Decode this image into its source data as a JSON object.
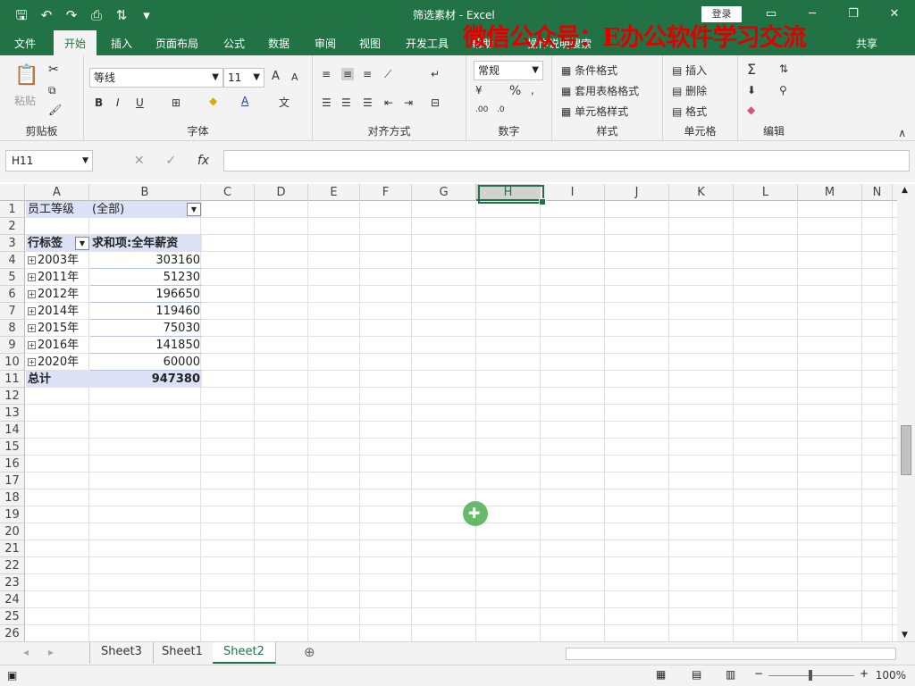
{
  "window": {
    "title": "筛选素材  -  Excel",
    "login": "登录"
  },
  "watermark": "微信公众号：E办公软件学习交流",
  "tabs": [
    "文件",
    "开始",
    "插入",
    "页面布局",
    "公式",
    "数据",
    "审阅",
    "视图",
    "开发工具",
    "帮助"
  ],
  "active_tab": "开始",
  "tell_me": "操作说明搜索",
  "share": "共享",
  "ribbon": {
    "clipboard": {
      "label": "剪贴板",
      "paste": "粘贴"
    },
    "font": {
      "label": "字体",
      "name": "等线",
      "size": "11"
    },
    "alignment": {
      "label": "对齐方式"
    },
    "number": {
      "label": "数字",
      "format": "常规"
    },
    "styles": {
      "label": "样式",
      "conditional": "条件格式",
      "table": "套用表格格式",
      "cell": "单元格样式"
    },
    "cells": {
      "label": "单元格",
      "insert": "插入",
      "delete": "删除",
      "format": "格式"
    },
    "editing": {
      "label": "编辑"
    }
  },
  "formula_bar": {
    "name_box": "H11",
    "formula": ""
  },
  "columns": [
    "A",
    "B",
    "C",
    "D",
    "E",
    "F",
    "G",
    "H",
    "I",
    "J",
    "K",
    "L",
    "M",
    "N"
  ],
  "selected_column": "H",
  "row_numbers": [
    "1",
    "2",
    "3",
    "4",
    "5",
    "6",
    "7",
    "8",
    "9",
    "10",
    "11",
    "12",
    "13",
    "14",
    "15",
    "16",
    "17",
    "18",
    "19",
    "20",
    "21",
    "22",
    "23",
    "24",
    "25",
    "26"
  ],
  "pivot": {
    "filter_label": "员工等级",
    "filter_value": "(全部)",
    "row_label_header": "行标签",
    "value_header": "求和项:全年薪资",
    "rows": [
      {
        "label": "2003年",
        "value": "303160"
      },
      {
        "label": "2011年",
        "value": "51230"
      },
      {
        "label": "2012年",
        "value": "196650"
      },
      {
        "label": "2014年",
        "value": "119460"
      },
      {
        "label": "2015年",
        "value": "75030"
      },
      {
        "label": "2016年",
        "value": "141850"
      },
      {
        "label": "2020年",
        "value": "60000"
      }
    ],
    "total_label": "总计",
    "total_value": "947380"
  },
  "sheets": [
    "Sheet3",
    "Sheet1",
    "Sheet2"
  ],
  "active_sheet": "Sheet2",
  "zoom": "100%"
}
